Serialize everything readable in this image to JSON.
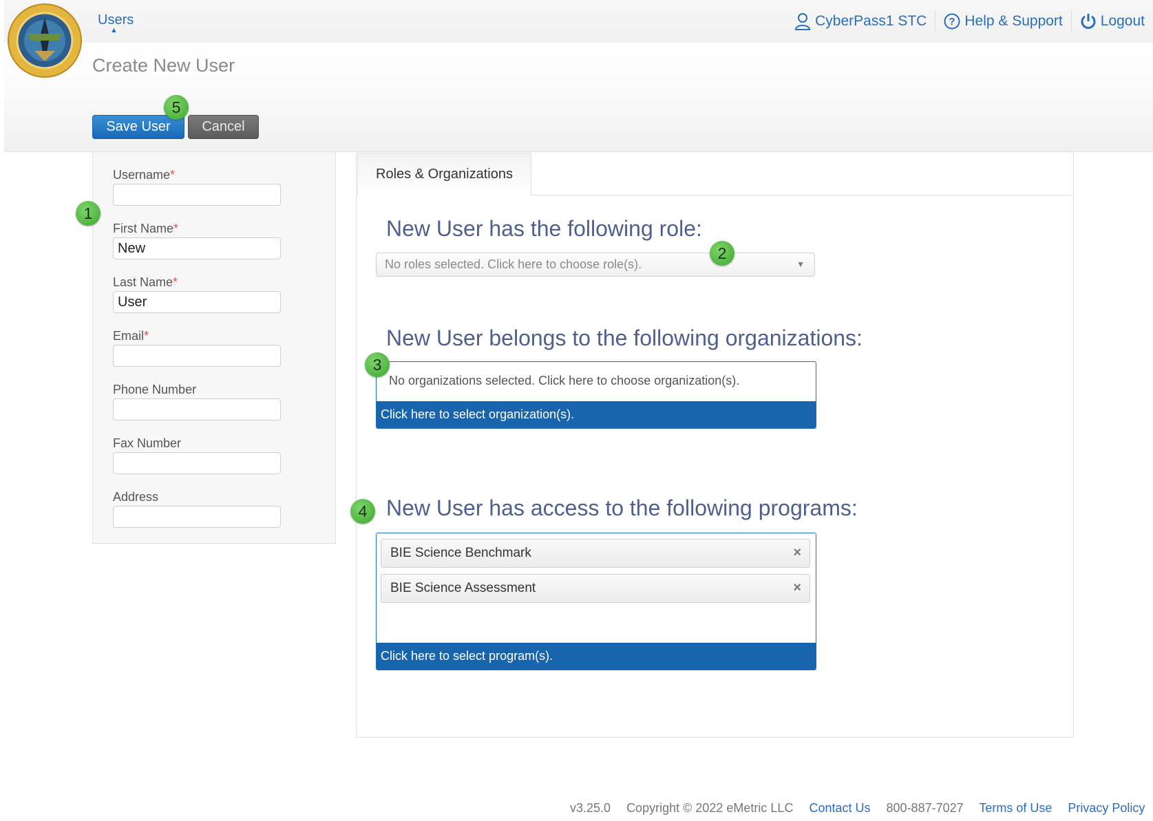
{
  "header": {
    "nav_users": "Users",
    "account_name": "CyberPass1 STC",
    "help": "Help & Support",
    "logout": "Logout"
  },
  "page": {
    "title": "Create New User",
    "save_button": "Save User",
    "cancel_button": "Cancel"
  },
  "badges": [
    "1",
    "2",
    "3",
    "4",
    "5"
  ],
  "form": {
    "username_label": "Username",
    "username_value": "",
    "first_name_label": "First Name",
    "first_name_value": "New",
    "last_name_label": "Last Name",
    "last_name_value": "User",
    "email_label": "Email",
    "email_value": "",
    "phone_label": "Phone Number",
    "phone_value": "",
    "fax_label": "Fax Number",
    "fax_value": "",
    "address_label": "Address",
    "address_value": "",
    "required_mark": "*"
  },
  "tabs": [
    {
      "label": "Roles & Organizations"
    }
  ],
  "roles": {
    "heading": "New User has the following role:",
    "placeholder": "No roles selected. Click here to choose role(s)."
  },
  "organizations": {
    "heading": "New User belongs to the following organizations:",
    "empty_text": "No organizations selected.  Click here to choose organization(s).",
    "select_link": "Click here to select organization(s)."
  },
  "programs": {
    "heading": "New User has access to the following programs:",
    "items": [
      "BIE Science Benchmark",
      "BIE Science Assessment"
    ],
    "select_link": "Click here to select program(s)."
  },
  "footer": {
    "version": "v3.25.0",
    "copyright": "Copyright © 2022 eMetric LLC",
    "contact": "Contact Us",
    "phone": "800-887-7027",
    "terms": "Terms of Use",
    "privacy": "Privacy Policy"
  },
  "colors": {
    "primary_blue": "#1865ae",
    "link_blue": "#2a6ebb",
    "heading_indigo": "#4f5f8e",
    "badge_green": "#4cb83d",
    "required_red": "#d9534f"
  }
}
